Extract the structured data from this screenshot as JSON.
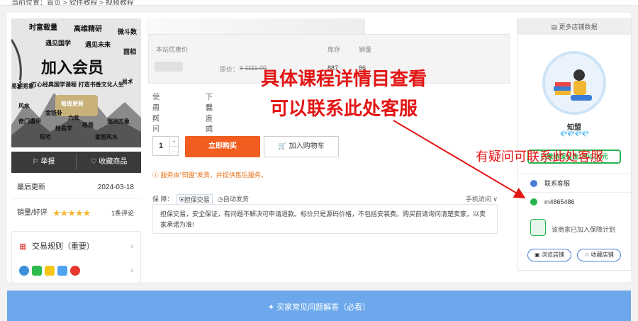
{
  "breadcrumb": "当前位置：首页 > 软件教程 > 视频教程",
  "cover": {
    "lines": [
      "时富载量",
      "高维精研",
      "微斗数",
      "遇见国学",
      "遇见未来",
      "面相",
      "加入会员",
      "易理易象",
      "万心经典国学课程 打造书香文化人生",
      "易术",
      "奇门遁甲",
      "金钱卦",
      "六爻",
      "格局",
      "瑞兆万象",
      "风水",
      "阳宅",
      "姓名学",
      "家居风水",
      "每周更新"
    ]
  },
  "left": {
    "report": "举报",
    "favorite": "收藏商品",
    "last_update_label": "最后更新",
    "last_update_value": "2024-03-18",
    "sales_label": "销量/好评",
    "stars": "★★★★★",
    "reviews": "1条评论",
    "rules": "交易规则（重要）"
  },
  "price": {
    "label": "本站优惠价",
    "original_prefix": "原价：",
    "original": "¥ 1111.00",
    "stock_label": "库存",
    "stock": "887",
    "sales_label": "销量",
    "sales": "86"
  },
  "usage": {
    "time_label": "使用时间",
    "time_value": "永久",
    "download_label": "下载方式",
    "download_value": "百度网盘"
  },
  "quantity": "1",
  "buy_now": "立即购买",
  "add_cart": "加入购物车",
  "service_note": "服务由\"知盟\"发货，并提供售后服务。",
  "guarantee": {
    "label": "保 障：",
    "g1": "担保交易",
    "g2": "自动发货",
    "mobile": "手机访问 ∨"
  },
  "notice": "担保交易，安全保证，有问题不解决可申请退款。标价只是源码价格，不包括安装费。购买前请询问清楚卖家，以卖家承诺为准!",
  "shop": {
    "header": "更多店铺数据",
    "name": "知盟",
    "gems": "💎💎💎💎",
    "deposit": "已缴纳保证金1000.00元",
    "contact": "联系客服",
    "wechat": "m4865486",
    "guarantee_text": "该商家已加入保障计划",
    "browse": "浏览店铺",
    "collect": "收藏店铺"
  },
  "faq": "买家常见问题解答（必看）",
  "annotations": {
    "big_line1": "具体课程详情目查看",
    "big_line2": "可以联系此处客服",
    "small": "有疑问可联系此处客服"
  },
  "colors": {
    "buy": "#f05d1e",
    "annotation": "#e31414",
    "faq_bar": "#6ca8eb",
    "green": "#25b44e"
  }
}
